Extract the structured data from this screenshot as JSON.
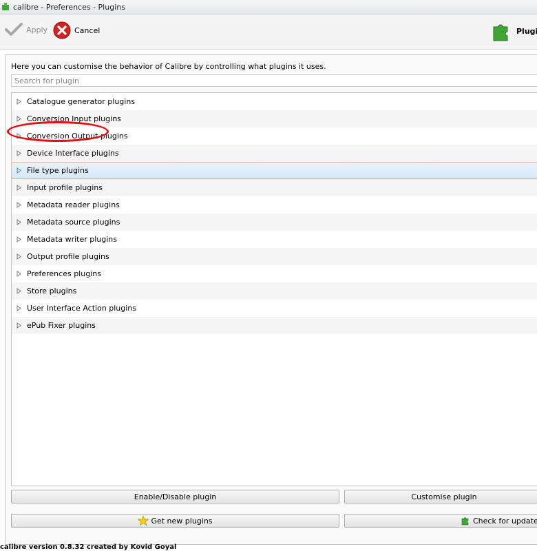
{
  "window": {
    "title": "calibre - Preferences - Plugins"
  },
  "toolbar": {
    "apply_label": "Apply",
    "cancel_label": "Cancel",
    "section_label": "Plugin"
  },
  "intro_text": "Here you can customise the behavior of Calibre by controlling what plugins it uses.",
  "search": {
    "placeholder": "Search for plugin",
    "value": ""
  },
  "plugin_categories": [
    {
      "label": "Catalogue generator plugins",
      "selected": false
    },
    {
      "label": "Conversion Input plugins",
      "selected": false
    },
    {
      "label": "Conversion Output plugins",
      "selected": false
    },
    {
      "label": "Device Interface plugins",
      "selected": false
    },
    {
      "label": "File type plugins",
      "selected": true
    },
    {
      "label": "Input profile plugins",
      "selected": false
    },
    {
      "label": "Metadata reader plugins",
      "selected": false
    },
    {
      "label": "Metadata source plugins",
      "selected": false
    },
    {
      "label": "Metadata writer plugins",
      "selected": false
    },
    {
      "label": "Output profile plugins",
      "selected": false
    },
    {
      "label": "Preferences plugins",
      "selected": false
    },
    {
      "label": "Store plugins",
      "selected": false
    },
    {
      "label": "User Interface Action plugins",
      "selected": false
    },
    {
      "label": "ePub Fixer plugins",
      "selected": false
    }
  ],
  "buttons": {
    "enable_disable": "Enable/Disable plugin",
    "customise": "Customise plugin",
    "get_new": "Get new plugins",
    "check_updates": "Check for updated plugins"
  },
  "status": {
    "version_text": "calibre version 0.8.32 created by Kovid Goyal"
  },
  "colors": {
    "highlight": "#e01010",
    "selection": "#d6e8fb",
    "cancel_red": "#d42020",
    "plugin_green": "#3fa535"
  }
}
